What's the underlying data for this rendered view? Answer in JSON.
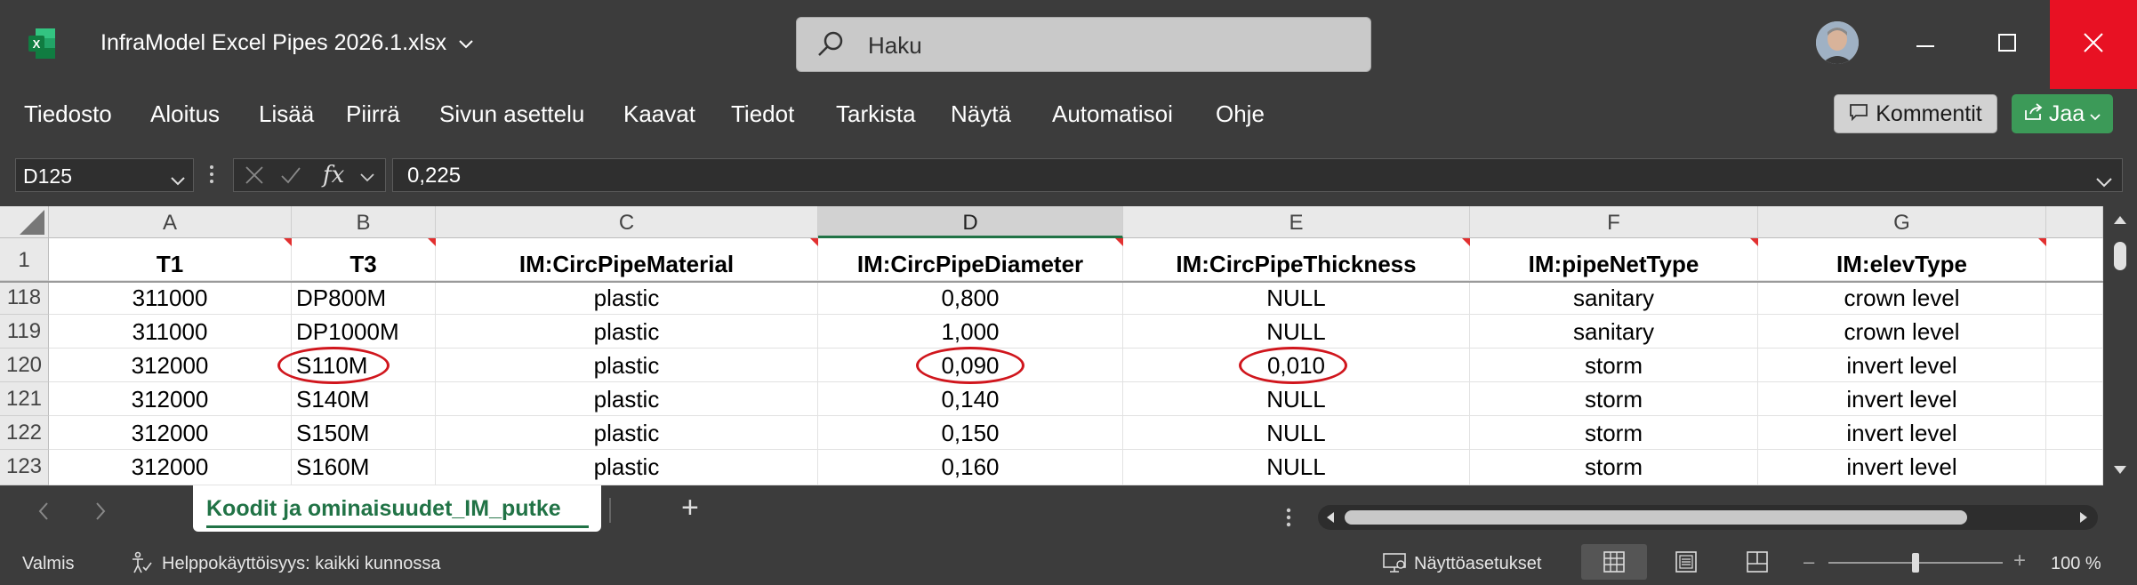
{
  "app": {
    "file_title": "InfraModel Excel Pipes 2026.1.xlsx",
    "search_placeholder": "Haku"
  },
  "ribbon": {
    "tabs": [
      "Tiedosto",
      "Aloitus",
      "Lisää",
      "Piirrä",
      "Sivun asettelu",
      "Kaavat",
      "Tiedot",
      "Tarkista",
      "Näytä",
      "Automatisoi",
      "Ohje"
    ],
    "comments_label": "Kommentit",
    "share_label": "Jaa"
  },
  "formula_bar": {
    "name_box": "D125",
    "formula_value": "0,225",
    "fx_label": "fx"
  },
  "sheet": {
    "columns": [
      "A",
      "B",
      "C",
      "D",
      "E",
      "F",
      "G"
    ],
    "selected_column": "D",
    "header_row": {
      "row_number": "1",
      "cells": [
        "T1",
        "T3",
        "IM:CircPipeMaterial",
        "IM:CircPipeDiameter",
        "IM:CircPipeThickness",
        "IM:pipeNetType",
        "IM:elevType"
      ]
    },
    "rows": [
      {
        "row_number": "118",
        "cells": [
          "311000",
          "DP800M",
          "plastic",
          "0,800",
          "NULL",
          "sanitary",
          "crown level"
        ]
      },
      {
        "row_number": "119",
        "cells": [
          "311000",
          "DP1000M",
          "plastic",
          "1,000",
          "NULL",
          "sanitary",
          "crown level"
        ]
      },
      {
        "row_number": "120",
        "cells": [
          "312000",
          "S110M",
          "plastic",
          "0,090",
          "0,010",
          "storm",
          "invert level"
        ]
      },
      {
        "row_number": "121",
        "cells": [
          "312000",
          "S140M",
          "plastic",
          "0,140",
          "NULL",
          "storm",
          "invert level"
        ]
      },
      {
        "row_number": "122",
        "cells": [
          "312000",
          "S150M",
          "plastic",
          "0,150",
          "NULL",
          "storm",
          "invert level"
        ]
      },
      {
        "row_number": "123",
        "cells": [
          "312000",
          "S160M",
          "plastic",
          "0,160",
          "NULL",
          "storm",
          "invert level"
        ]
      }
    ]
  },
  "sheet_tabs": {
    "active": "Koodit ja ominaisuudet_IM_putke",
    "add_symbol": "+"
  },
  "status": {
    "ready": "Valmis",
    "accessibility": "Helppokäyttöisyys: kaikki kunnossa",
    "display_settings": "Näyttöasetukset",
    "zoom": "100 %"
  },
  "colors": {
    "accent_green": "#217346",
    "share_green": "#3c9a58",
    "close_red": "#e81123",
    "annotation_red": "#d0161d"
  }
}
